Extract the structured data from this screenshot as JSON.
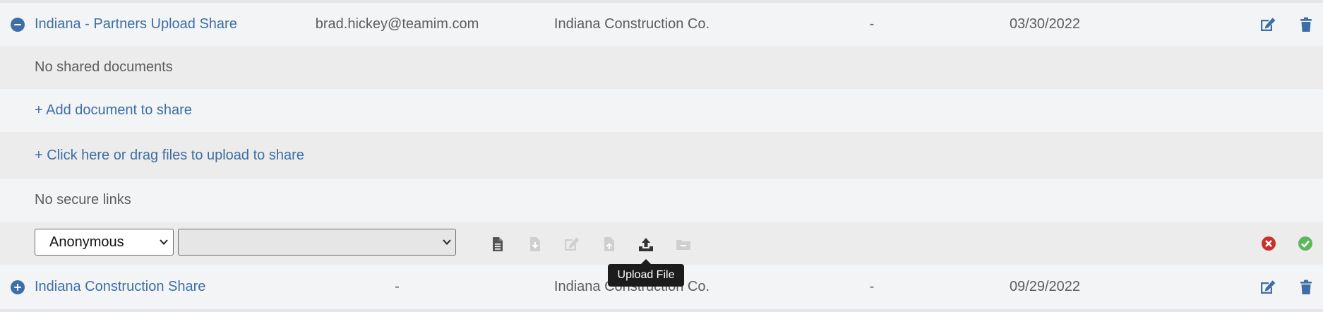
{
  "shares": [
    {
      "name": "Indiana - Partners Upload Share",
      "email": "brad.hickey@teamim.com",
      "company": "Indiana Construction Co.",
      "extra": "-",
      "date": "03/30/2022",
      "expanded": true
    },
    {
      "name": "Indiana Construction Share",
      "email": "-",
      "company": "Indiana Construction Co.",
      "extra": "-",
      "date": "09/29/2022",
      "expanded": false
    }
  ],
  "expanded_panel": {
    "no_documents": "No shared documents",
    "add_document": "+ Add document to share",
    "upload_prompt": "+ Click here or drag files to upload to share",
    "no_links": "No secure links",
    "access_select": {
      "value": "Anonymous",
      "options": [
        "Anonymous"
      ]
    },
    "permission_select": {
      "value": ""
    },
    "toolbar": [
      {
        "icon": "file-text-icon",
        "enabled": true
      },
      {
        "icon": "file-download-icon",
        "enabled": false
      },
      {
        "icon": "file-edit-icon",
        "enabled": false
      },
      {
        "icon": "file-upload-icon",
        "enabled": false
      },
      {
        "icon": "upload-icon",
        "enabled": true,
        "hover": true
      },
      {
        "icon": "folder-minus-icon",
        "enabled": false
      }
    ],
    "tooltip": "Upload File"
  },
  "colors": {
    "link": "#3d6ea5",
    "cancel": "#c9302c",
    "confirm": "#5cb85c",
    "icon_enabled": "#555555",
    "icon_disabled": "#cfcfcf"
  }
}
